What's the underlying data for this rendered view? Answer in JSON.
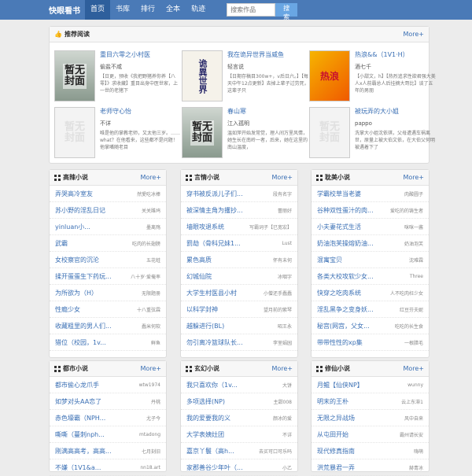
{
  "header": {
    "logo": "快眼看书",
    "nav": [
      "首页",
      "书库",
      "排行",
      "全本",
      "轨迹"
    ],
    "search_placeholder": "搜索作品",
    "search_button": "搜 索"
  },
  "recommend": {
    "title": "推荐阅读",
    "more": "More+",
    "items": [
      {
        "title": "重目六零之小村医",
        "author": "偷盐不咸",
        "desc": "【日更，预收《我把野猪养你养【八零】》求收藏】重目出身中医世家，上一世的老猪下",
        "cover_text": "暂无\n封面",
        "cover_style": "placeholder_img"
      },
      {
        "title": "我在诡异世界当威鱼",
        "author": "轻言说",
        "desc": "【日期存稿目300w+，v后日六。】【每天中午12点更新】去掉上辈子过劳死，这辈子只",
        "cover_text": "",
        "cover_style": "calligraphy"
      },
      {
        "title": "热浪&&（1V1·H）",
        "author": "酒七千",
        "desc": "【小甜文，h】【热烈追求性欲君强大美人x人前霸总人后挂摘大哥比】谈了五年的男朋",
        "cover_text": "热浪",
        "cover_style": "heatwave"
      },
      {
        "title": "老师守心怡",
        "author": "不详",
        "desc": "唯是他的掌教老师，又太他三岁。……what？在他看来，这些都不是问题！他掌嘴随老目",
        "cover_text": "暂无\n封面",
        "cover_style": "blank"
      },
      {
        "title": "春山寒",
        "author": "江入孤明",
        "desc": "温如萍开始发常觉，理人间万里风情，她生长在南岭一者，后来，她在这里的南山温度，",
        "cover_text": "暂无\n封面",
        "cover_style": "placeholder_img"
      },
      {
        "title": "被玩弄的大小姐",
        "author": "pappo",
        "desc": "洗掌大小姐沈依琪，父母遭遇车祸离世，原量上被大伯文依，在大伯父何明被遇着下了",
        "cover_text": "暂无\n封面",
        "cover_style": "blank"
      }
    ]
  },
  "panels": [
    {
      "title": "高辣小说",
      "more": "More+",
      "rows": [
        [
          "弄哭高冷室友",
          "然愛吃冰棒"
        ],
        [
          "苏小野的淫乱日记",
          "关关雎鸠"
        ],
        [
          "yinluan小...",
          "墨离殇"
        ],
        [
          "武霸",
          "吃肉的长翅膀"
        ],
        [
          "女校察官的沉沦",
          "五花蛙"
        ],
        [
          "揉开蛋蛋生下药玩...",
          "八十岁·爱俺率"
        ],
        [
          "为所欲为（H）",
          "无限题册"
        ],
        [
          "性瘾少女",
          "十八重弦霖"
        ],
        [
          "收藏粗里的男人们...",
          "蠢米何软"
        ],
        [
          "猎位（校园，1v...",
          "鲜鱼"
        ]
      ]
    },
    {
      "title": "言情小说",
      "more": "More+",
      "rows": [
        [
          "穿书被反派儿子们...",
          "段有名字"
        ],
        [
          "被深情主角为攫抄...",
          "蕾丽好"
        ],
        [
          "墙眼攻退系统",
          "写霸词子【已宽宏】"
        ],
        [
          "罰劫（骨科兄妹1...",
          "Lust"
        ],
        [
          "累色高质",
          "怀有未何"
        ],
        [
          "幻城仙院",
          "冰咽字"
        ],
        [
          "大学生村医县小村",
          "小僧还手蠢蠢"
        ],
        [
          "以科学封神",
          "望月前的紫琴"
        ],
        [
          "越躲进行(BL)",
          "昭王永"
        ],
        [
          "勿引离冷篮球队长...",
          "李室娟园"
        ]
      ]
    },
    {
      "title": "耽美小说",
      "more": "More+",
      "rows": [
        [
          "学霸校草当老婆",
          "肉酸圆子"
        ],
        [
          "谷种双性蛋汁的肉...",
          "爱吃的的铸生者"
        ],
        [
          "小夫妻花式生活",
          "咪咪一酱"
        ],
        [
          "奶油泡芙操熔奶油...",
          "奶油泡芙"
        ],
        [
          "混寓宝贝",
          "沈难霖"
        ],
        [
          "各类大校攻软少女...",
          "Three"
        ],
        [
          "快穿之吃肉系统",
          "人不吃肉枉少女"
        ],
        [
          "淫乱黑争之变身妖...",
          "红豆芬夫妮"
        ],
        [
          "秘宫(网宫，父女...",
          "吃吃的长生食"
        ],
        [
          "带带性性的xp集",
          "一根腊毛"
        ]
      ]
    },
    {
      "title": "都市小说",
      "more": "More+",
      "rows": [
        [
          "都市偷心龙爪手",
          "wtw1974"
        ],
        [
          "如梦对头AA恋了",
          "丹桃"
        ],
        [
          "赤色壕霸（NPH...",
          "尤子今"
        ],
        [
          "嘶嘶（蔓刺nph...",
          "mtadong"
        ],
        [
          "刚满高高考，高高...",
          "七月刻旧"
        ],
        [
          "不嫌（1V1&a...",
          "nn18.art"
        ]
      ]
    },
    {
      "title": "玄幻小说",
      "more": "More+",
      "rows": [
        [
          "我只喜欢你（1v...",
          "大饼"
        ],
        [
          "多项选择(NP)",
          "主甜008"
        ],
        [
          "我的爱要我的义",
          "颜冰的爱"
        ],
        [
          "大学表姨灶团",
          "不详"
        ],
        [
          "嘉京丫鬟（高h...",
          "去买可口可乐吗"
        ],
        [
          "家郡善谷少年叶（...",
          "小乙"
        ]
      ]
    },
    {
      "title": "修仙小说",
      "more": "More+",
      "rows": [
        [
          "月鲲【仙侠NP】",
          "wunny"
        ],
        [
          "明末的王朴",
          "云上东滞1"
        ],
        [
          "无限之异战场",
          "风中自来"
        ],
        [
          "从屯田开始",
          "霸州请长安"
        ],
        [
          "现代修真指南",
          "嗨萌"
        ],
        [
          "洪荒暴君一弄",
          "赫青冰"
        ]
      ]
    }
  ]
}
